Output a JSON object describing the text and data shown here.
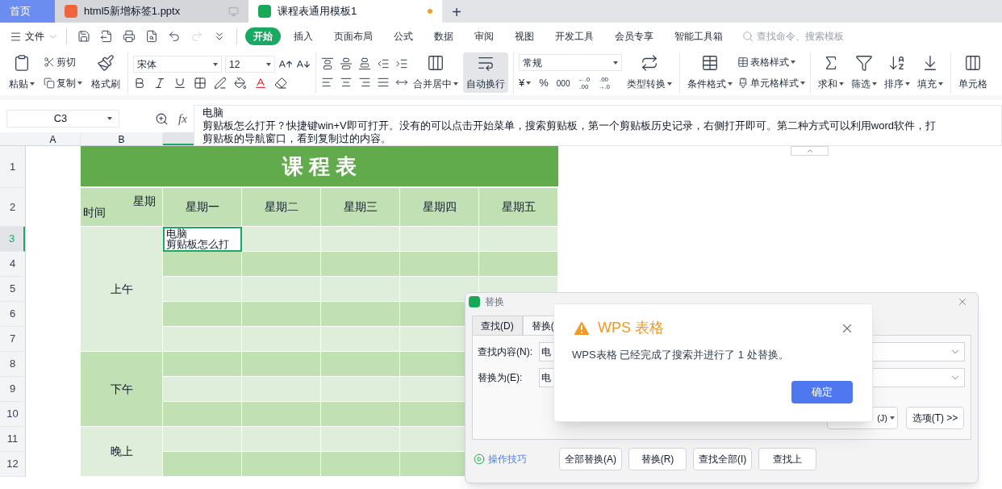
{
  "tabs": [
    {
      "label": "首页",
      "kind": "home",
      "selected": false,
      "unsaved": false
    },
    {
      "label": "html5新增标签1.pptx",
      "kind": "slides",
      "selected": false,
      "unsaved": false
    },
    {
      "label": "课程表通用模板1",
      "kind": "sheet",
      "selected": true,
      "unsaved": true
    }
  ],
  "new_tab": "+",
  "menu": {
    "file": "文件",
    "items": [
      {
        "label": "开始",
        "selected": true
      },
      {
        "label": "插入",
        "selected": false
      },
      {
        "label": "页面布局",
        "selected": false
      },
      {
        "label": "公式",
        "selected": false
      },
      {
        "label": "数据",
        "selected": false
      },
      {
        "label": "审阅",
        "selected": false
      },
      {
        "label": "视图",
        "selected": false
      },
      {
        "label": "开发工具",
        "selected": false
      },
      {
        "label": "会员专享",
        "selected": false
      },
      {
        "label": "智能工具箱",
        "selected": false
      }
    ],
    "search_placeholder": "查找命令、搜索模板"
  },
  "ribbon": {
    "paste": "粘贴",
    "cut": "剪切",
    "copy": "复制",
    "format_painter": "格式刷",
    "font_name": "宋体",
    "font_size": "12",
    "merge": "合并居中",
    "wrap": {
      "label": "自动换行",
      "selected": true
    },
    "number_format": "常规",
    "currency": "¥",
    "percent": "%",
    "thousands": "000",
    "decimal_more": {
      "top": "←.0",
      "bottom": ".00"
    },
    "decimal_less": {
      "top": ".00",
      "bottom": "→.0"
    },
    "convert": "类型转换",
    "conditional": "条件格式",
    "table_style": "表格样式",
    "cell_style": "单元格样式",
    "sum": "求和",
    "filter": "筛选",
    "sort": "排序",
    "fill": "填充",
    "cells": "单元格"
  },
  "name_box": "C3",
  "fx": "fx",
  "formula_lines": [
    "电脑",
    "剪贴板怎么打开？快捷键win+V即可打开。没有的可以点击开始菜单，搜索剪贴板，第一个剪贴板历史记录，右侧打开即可。第二种方式可以利用word软件，打",
    "剪贴板的导航窗口，看到复制过的内容。"
  ],
  "column_headers": [
    {
      "label": "A",
      "selected": false
    },
    {
      "label": "B",
      "selected": false
    },
    {
      "selected": true
    }
  ],
  "row_headers": [
    {
      "label": "1",
      "selected": false
    },
    {
      "label": "2",
      "selected": false
    },
    {
      "label": "3",
      "selected": true
    },
    {
      "label": "4",
      "selected": false
    },
    {
      "label": "5",
      "selected": false
    },
    {
      "label": "6",
      "selected": false
    },
    {
      "label": "7",
      "selected": false
    },
    {
      "label": "8",
      "selected": false
    },
    {
      "label": "9",
      "selected": false
    },
    {
      "label": "10",
      "selected": false
    },
    {
      "label": "11",
      "selected": false
    },
    {
      "label": "12",
      "selected": false
    }
  ],
  "schedule": {
    "title": "课 程 表",
    "corner_top": "星期",
    "corner_bottom": "时间",
    "days": [
      "星期一",
      "星期二",
      "星期三",
      "星期四",
      "星期五"
    ],
    "periods": [
      "上午",
      "下午",
      "晚上"
    ],
    "active_cell": [
      "电脑",
      "剪贴板怎么打"
    ]
  },
  "replace_dialog": {
    "title": "替换",
    "tabs": [
      {
        "label": "查找(D)",
        "selected": false
      },
      {
        "label": "替换(",
        "selected": true
      }
    ],
    "find_label": "查找内容(N):",
    "find_value": "电",
    "replace_label": "替换为(E):",
    "replace_value": "电",
    "format_button": "(J)",
    "options_button": "选项(T) >>",
    "tips": "操作技巧",
    "buttons": [
      "全部替换(A)",
      "替换(R)",
      "查找全部(I)",
      "查找上"
    ]
  },
  "alert": {
    "title": "WPS 表格",
    "message": "WPS表格 已经完成了搜索并进行了 1 处替换。",
    "ok": "确定"
  }
}
